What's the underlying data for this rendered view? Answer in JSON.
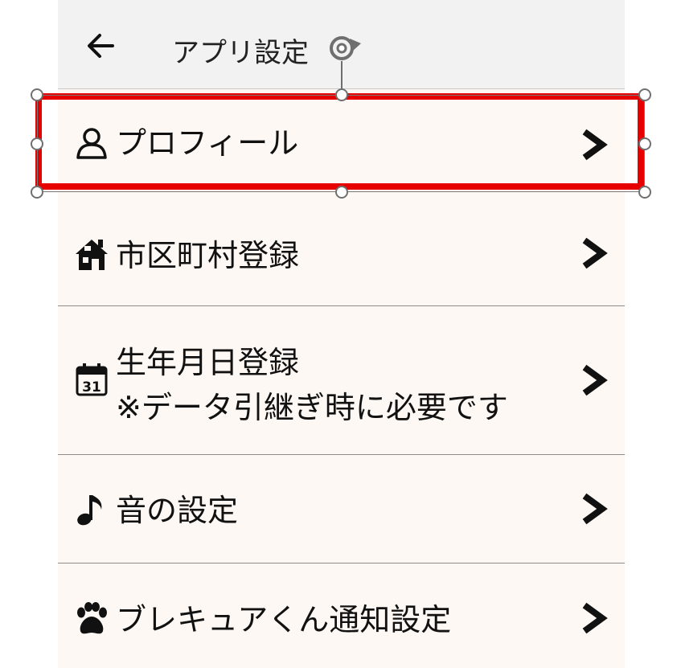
{
  "header": {
    "back_icon": "arrow-left-icon",
    "title": "アプリ設定"
  },
  "menu": [
    {
      "id": "profile",
      "icon": "person-icon",
      "lines": [
        "プロフィール"
      ]
    },
    {
      "id": "municipality",
      "icon": "house-icon",
      "lines": [
        "市区町村登録"
      ]
    },
    {
      "id": "birthday",
      "icon": "calendar-icon",
      "calendar_day": "31",
      "lines": [
        "生年月日登録",
        "※データ引継ぎ時に必要です"
      ]
    },
    {
      "id": "sound",
      "icon": "music-note-icon",
      "lines": [
        "音の設定"
      ]
    },
    {
      "id": "notify",
      "icon": "paw-icon",
      "lines": [
        "ブレキュアくん通知設定"
      ]
    }
  ],
  "chevron_icon": "chevron-right-icon",
  "colors": {
    "header_bg": "#f2f2f2",
    "row_bg": "#fdf8f3",
    "selection_red": "#e60000",
    "divider": "#8c8c8c"
  }
}
